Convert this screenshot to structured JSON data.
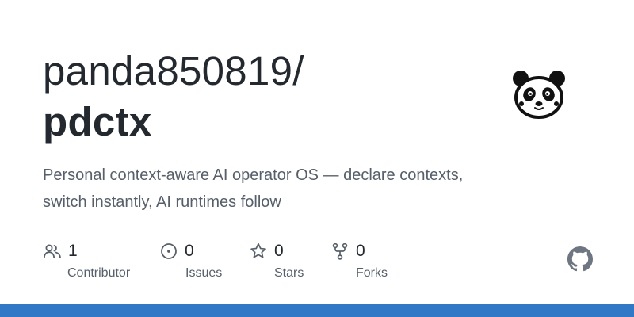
{
  "repo": {
    "owner": "panda850819/",
    "name": "pdctx",
    "description": "Personal context-aware AI operator OS — declare contexts, switch instantly, AI runtimes follow"
  },
  "stats": [
    {
      "key": "contributors",
      "value": "1",
      "label": "Contributor",
      "icon": "people-icon"
    },
    {
      "key": "issues",
      "value": "0",
      "label": "Issues",
      "icon": "issue-opened-icon"
    },
    {
      "key": "stars",
      "value": "0",
      "label": "Stars",
      "icon": "star-icon"
    },
    {
      "key": "forks",
      "value": "0",
      "label": "Forks",
      "icon": "repo-forked-icon"
    }
  ],
  "colors": {
    "language_bar": "#3178c6",
    "title": "#24292f",
    "muted": "#57606a"
  },
  "icons": {
    "avatar": "panda-avatar",
    "brand": "github-mark-icon"
  }
}
